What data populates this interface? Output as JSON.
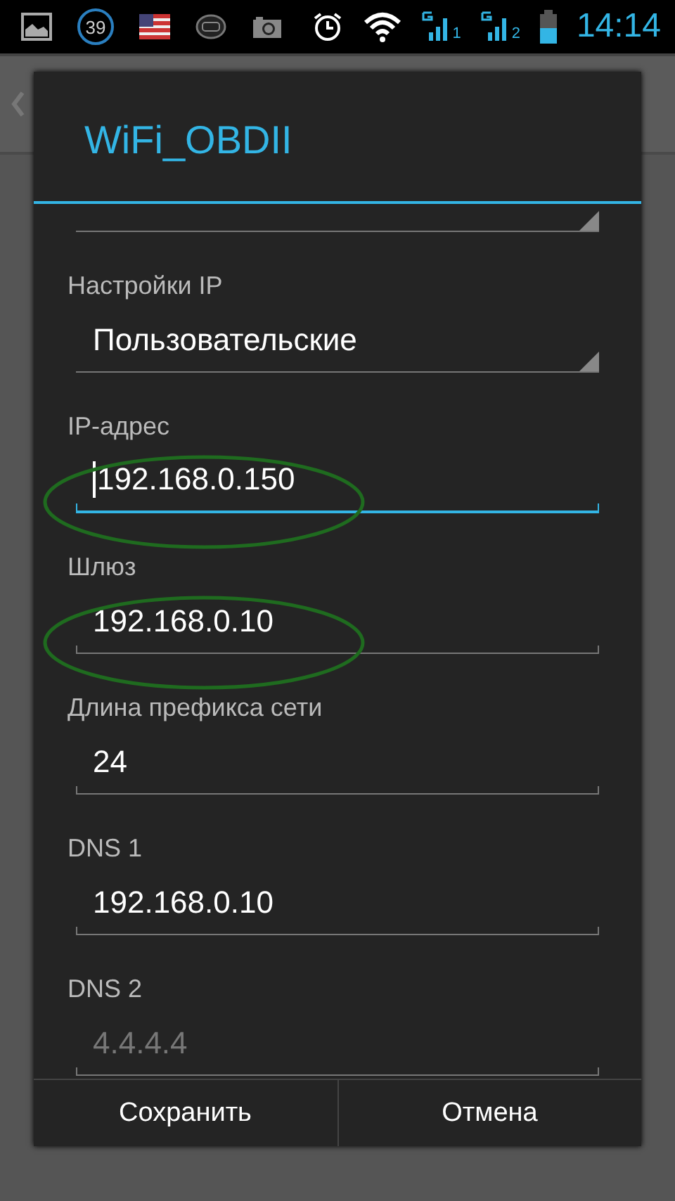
{
  "status_bar": {
    "notification_badge": "39",
    "sim_1": "1",
    "sim_2": "2",
    "time": "14:14"
  },
  "dialog": {
    "title": "WiFi_OBDII",
    "items": [
      {
        "kind": "spinner"
      },
      {
        "kind": "label",
        "text": "Настройки IP"
      },
      {
        "kind": "spinner",
        "value": "Пользовательские"
      },
      {
        "kind": "label",
        "text": "IP-адрес"
      },
      {
        "kind": "field",
        "value": "192.168.0.150",
        "focused": true,
        "circled": true
      },
      {
        "kind": "label",
        "text": "Шлюз"
      },
      {
        "kind": "field",
        "value": "192.168.0.10",
        "focused": false,
        "circled": true
      },
      {
        "kind": "label",
        "text": "Длина префикса сети"
      },
      {
        "kind": "field",
        "value": "24",
        "focused": false,
        "circled": false
      },
      {
        "kind": "label",
        "text": "DNS 1"
      },
      {
        "kind": "field",
        "value": "192.168.0.10",
        "focused": false,
        "circled": false
      },
      {
        "kind": "label",
        "text": "DNS 2"
      },
      {
        "kind": "field",
        "placeholder": "4.4.4.4",
        "focused": false,
        "circled": false
      }
    ],
    "buttons": [
      "Сохранить",
      "Отмена"
    ]
  }
}
